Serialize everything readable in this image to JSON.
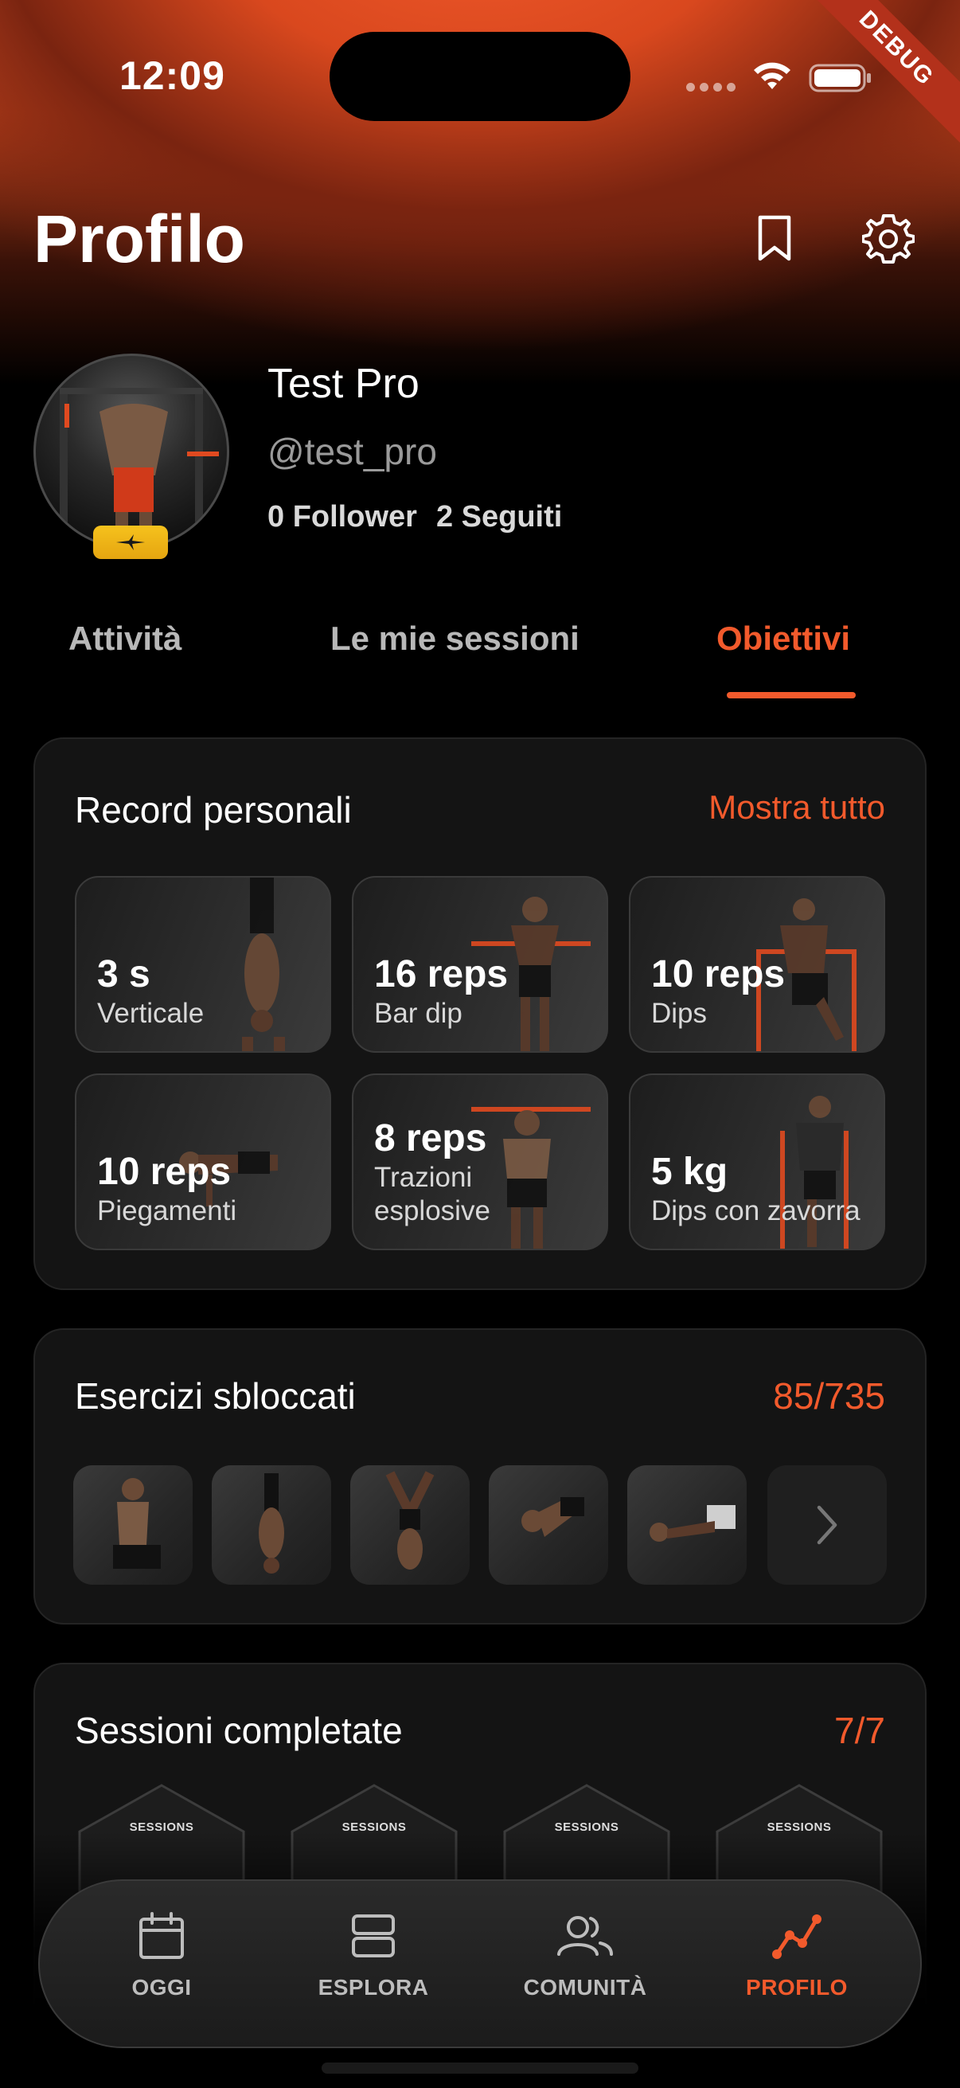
{
  "status_bar": {
    "time": "12:09",
    "debug_label": "DEBUG"
  },
  "header": {
    "title": "Profilo"
  },
  "profile": {
    "display_name": "Test Pro",
    "username": "@test_pro",
    "followers_count": "0",
    "followers_label": "Follower",
    "following_count": "2",
    "following_label": "Seguiti"
  },
  "tabs": [
    {
      "label": "Attività",
      "active": false
    },
    {
      "label": "Le mie sessioni",
      "active": false
    },
    {
      "label": "Obiettivi",
      "active": true
    }
  ],
  "records": {
    "title": "Record personali",
    "action": "Mostra tutto",
    "items": [
      {
        "value": "3 s",
        "label": "Verticale"
      },
      {
        "value": "16 reps",
        "label": "Bar dip"
      },
      {
        "value": "10 reps",
        "label": "Dips"
      },
      {
        "value": "10 reps",
        "label": "Piegamenti"
      },
      {
        "value": "8 reps",
        "label_line1": "Trazioni",
        "label_line2": "esplosive"
      },
      {
        "value": "5 kg",
        "label": "Dips con zavorra"
      }
    ]
  },
  "unlocked": {
    "title": "Esercizi sbloccati",
    "count": "85/735"
  },
  "sessions": {
    "title": "Sessioni completate",
    "count": "7/7",
    "badge_label": "SESSIONS"
  },
  "nav": [
    {
      "label": "OGGI",
      "icon": "calendar-icon",
      "active": false
    },
    {
      "label": "ESPLORA",
      "icon": "explore-icon",
      "active": false
    },
    {
      "label": "COMUNITÀ",
      "icon": "community-icon",
      "active": false
    },
    {
      "label": "PROFILO",
      "icon": "profile-chart-icon",
      "active": true
    }
  ],
  "colors": {
    "accent": "#f25a2c",
    "card_bg": "#141414",
    "badge_gold": "#f6c21d"
  }
}
